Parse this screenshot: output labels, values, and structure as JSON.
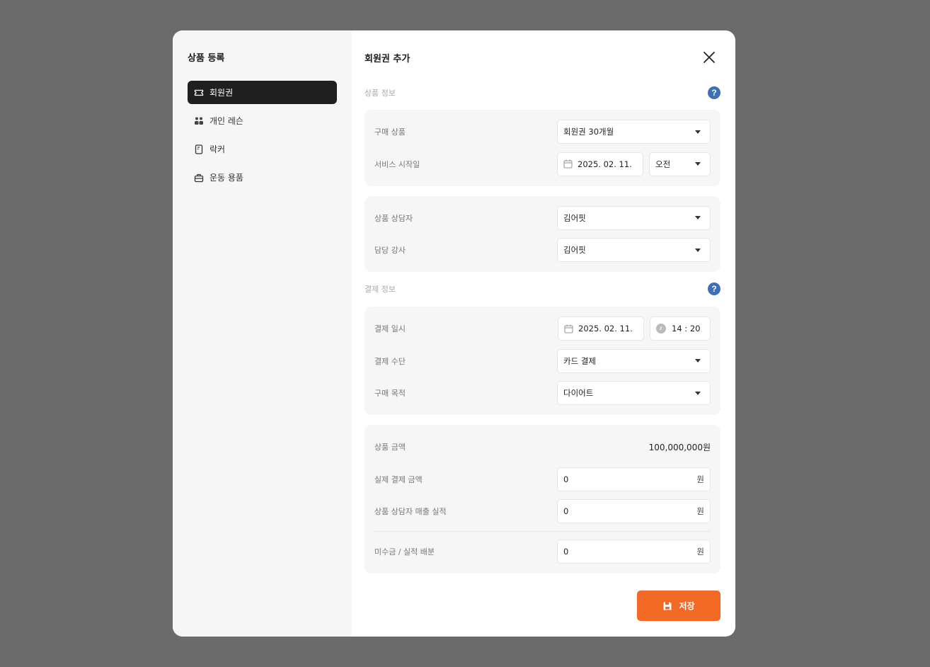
{
  "sidebar": {
    "title": "상품 등록",
    "items": [
      {
        "label": "회원권",
        "icon": "ticket-icon",
        "active": true
      },
      {
        "label": "개인 레슨",
        "icon": "people-icon",
        "active": false
      },
      {
        "label": "락커",
        "icon": "locker-icon",
        "active": false
      },
      {
        "label": "운동 용품",
        "icon": "bag-icon",
        "active": false
      }
    ]
  },
  "header": {
    "title": "회원권 추가"
  },
  "product_info": {
    "label": "상품 정보",
    "purchase_product": {
      "label": "구매 상품",
      "value": "회원권 30개월"
    },
    "service_start": {
      "label": "서비스 시작일",
      "date": "2025. 02. 11.",
      "ampm": "오전"
    },
    "consultant": {
      "label": "상품 상담자",
      "value": "김어핏"
    },
    "instructor": {
      "label": "담당 강사",
      "value": "김어핏"
    }
  },
  "payment_info": {
    "label": "결제 정보",
    "payment_datetime": {
      "label": "결제 일시",
      "date": "2025. 02. 11.",
      "time": "14 : 20"
    },
    "payment_method": {
      "label": "결제 수단",
      "value": "카드 결제"
    },
    "purchase_purpose": {
      "label": "구매 목적",
      "value": "다이어트"
    }
  },
  "amounts": {
    "product_amount": {
      "label": "상품 금액",
      "value": "100,000,000원"
    },
    "actual_payment": {
      "label": "실제 결제 금액",
      "value": "0",
      "unit": "원"
    },
    "consultant_sales": {
      "label": "상품 상담자 매출 실적",
      "value": "0",
      "unit": "원"
    },
    "outstanding": {
      "label": "미수금 / 실적 배분",
      "value": "0",
      "unit": "원"
    }
  },
  "save_button": {
    "label": "저장"
  },
  "colors": {
    "accent": "#f26a25",
    "help": "#3f6fb6",
    "sidebar_active": "#1f1f1f",
    "backdrop": "#6b6b6b"
  }
}
